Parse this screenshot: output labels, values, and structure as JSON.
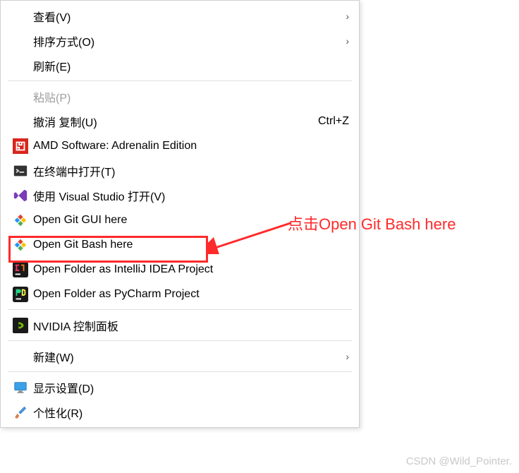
{
  "menu": {
    "view": {
      "label": "查看(V)"
    },
    "sort": {
      "label": "排序方式(O)"
    },
    "refresh": {
      "label": "刷新(E)"
    },
    "paste": {
      "label": "粘贴(P)"
    },
    "undo_copy": {
      "label": "撤消 复制(U)",
      "shortcut": "Ctrl+Z"
    },
    "amd": {
      "label": "AMD Software: Adrenalin Edition"
    },
    "terminal": {
      "label": "在终端中打开(T)"
    },
    "vs": {
      "label": "使用 Visual Studio 打开(V)"
    },
    "git_gui": {
      "label": "Open Git GUI here"
    },
    "git_bash": {
      "label": "Open Git Bash here"
    },
    "idea": {
      "label": "Open Folder as IntelliJ IDEA Project"
    },
    "pycharm": {
      "label": "Open Folder as PyCharm Project"
    },
    "nvidia": {
      "label": "NVIDIA 控制面板"
    },
    "new": {
      "label": "新建(W)"
    },
    "display": {
      "label": "显示设置(D)"
    },
    "personalize": {
      "label": "个性化(R)"
    }
  },
  "annotation": {
    "text": "点击Open Git Bash here"
  },
  "watermark": {
    "text": "CSDN @Wild_Pointer."
  }
}
